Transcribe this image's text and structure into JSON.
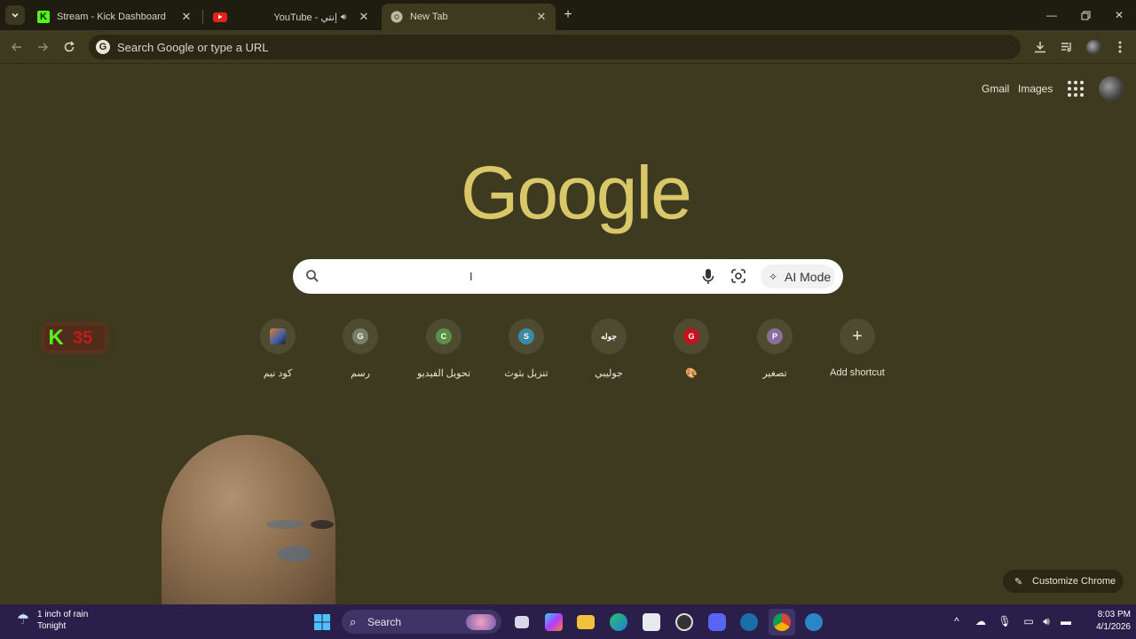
{
  "tabs": [
    {
      "title": "Stream - Kick Dashboard",
      "favicon": "kick-icon",
      "active": false
    },
    {
      "title": "YouTube - إنتي",
      "favicon": "youtube-icon",
      "audio": true,
      "active": false
    },
    {
      "title": "New Tab",
      "favicon": "chrome-icon",
      "active": true
    }
  ],
  "omnibox": {
    "placeholder": "Search Google or type a URL"
  },
  "ntp": {
    "links": {
      "gmail": "Gmail",
      "images": "Images"
    },
    "logo": "Google",
    "search": {
      "placeholder": "",
      "ai_mode_label": "AI Mode"
    },
    "shortcuts": [
      {
        "label": "كود نيم",
        "initial": "",
        "color": "#3b5fa8"
      },
      {
        "label": "رسم",
        "initial": "G",
        "color": "#7a7f6a"
      },
      {
        "label": "تحويل الفيديو",
        "initial": "C",
        "color": "#5a8f4a"
      },
      {
        "label": "تنزيل بثوث",
        "initial": "S",
        "color": "#3a8aa8"
      },
      {
        "label": "جوليبي",
        "initial": "جوله",
        "color": "#5a5a5a"
      },
      {
        "label": "🎨",
        "initial": "G",
        "color": "#c8101e"
      },
      {
        "label": "تصغير",
        "initial": "P",
        "color": "#8a6ea0"
      },
      {
        "label": "Add shortcut",
        "initial": "+",
        "color": "transparent"
      }
    ],
    "customize_label": "Customize Chrome"
  },
  "overlay": {
    "kick_letter": "K",
    "count": "35"
  },
  "taskbar": {
    "weather": {
      "line1": "1 inch of rain",
      "line2": "Tonight"
    },
    "search_label": "Search",
    "clock": {
      "time": "8:03 PM",
      "date": "4/1/2026"
    }
  }
}
